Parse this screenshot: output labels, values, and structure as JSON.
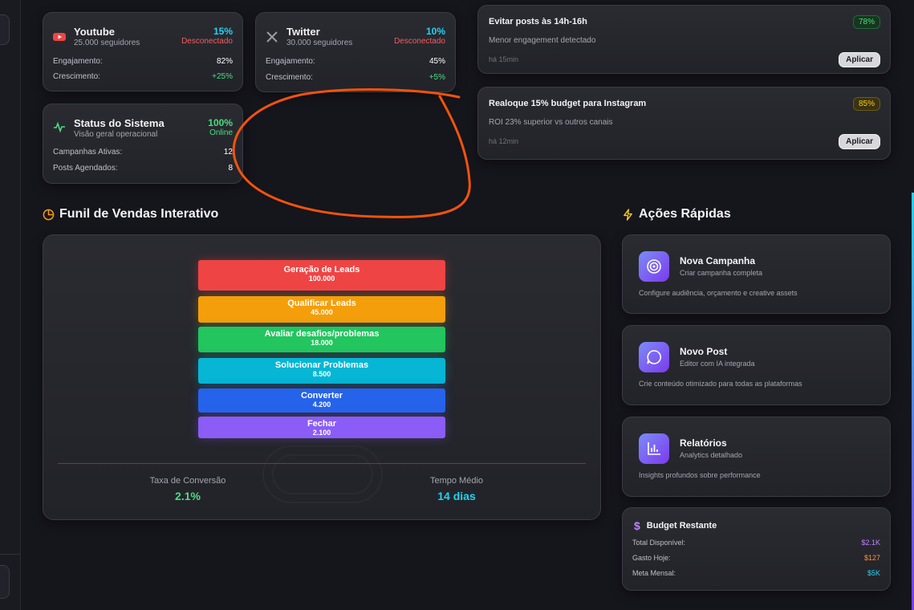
{
  "social": [
    {
      "name": "Youtube",
      "followers": "25.000 seguidores",
      "percent": "15%",
      "status": "Desconectado",
      "engagement_label": "Engajamento:",
      "engagement": "82%",
      "growth_label": "Crescimento:",
      "growth": "+25%"
    },
    {
      "name": "Twitter",
      "followers": "30.000 seguidores",
      "percent": "10%",
      "status": "Desconectado",
      "engagement_label": "Engajamento:",
      "engagement": "45%",
      "growth_label": "Crescimento:",
      "growth": "+5%"
    }
  ],
  "system": {
    "title": "Status do Sistema",
    "subtitle": "Visão geral operacional",
    "percent": "100%",
    "status": "Online",
    "rows": [
      {
        "label": "Campanhas Ativas:",
        "value": "12"
      },
      {
        "label": "Posts Agendados:",
        "value": "8"
      }
    ]
  },
  "recommendations": [
    {
      "title": "Evitar posts às 14h-16h",
      "desc": "Menor engagement detectado",
      "time": "há 15min",
      "score": "78%",
      "color": "#4ade80",
      "action": "Aplicar"
    },
    {
      "title": "Realoque 15% budget para Instagram",
      "desc": "ROI 23% superior vs outros canais",
      "time": "há 12min",
      "score": "85%",
      "color": "#facc15",
      "action": "Aplicar"
    }
  ],
  "funnel": {
    "title": "Funil de Vendas Interativo",
    "stages": [
      {
        "label": "Geração de Leads",
        "value": "100.000",
        "color": "#ef4444"
      },
      {
        "label": "Qualificar Leads",
        "value": "45.000",
        "color": "#f59e0b"
      },
      {
        "label": "Avaliar desafios/problemas",
        "value": "18.000",
        "color": "#22c55e"
      },
      {
        "label": "Solucionar Problemas",
        "value": "8.500",
        "color": "#06b6d4"
      },
      {
        "label": "Converter",
        "value": "4.200",
        "color": "#2563eb"
      },
      {
        "label": "Fechar",
        "value": "2.100",
        "color": "#8b5cf6"
      }
    ],
    "conversion_label": "Taxa de Conversão",
    "conversion": "2.1%",
    "time_label": "Tempo Médio",
    "time": "14 dias"
  },
  "quick_actions": {
    "title": "Ações Rápidas",
    "items": [
      {
        "title": "Nova Campanha",
        "subtitle": "Criar campanha completa",
        "desc": "Configure audiência, orçamento e creative assets",
        "icon": "target-icon"
      },
      {
        "title": "Novo Post",
        "subtitle": "Editor com IA integrada",
        "desc": "Crie conteúdo otimizado para todas as plataformas",
        "icon": "chat-bubble-icon"
      },
      {
        "title": "Relatórios",
        "subtitle": "Analytics detalhado",
        "desc": "Insights profundos sobre performance",
        "icon": "bar-chart-icon"
      }
    ]
  },
  "budget": {
    "title": "Budget Restante",
    "rows": [
      {
        "label": "Total Disponível:",
        "value": "$2.1K",
        "color": "#c084fc"
      },
      {
        "label": "Gasto Hoje:",
        "value": "$127",
        "color": "#fb923c"
      },
      {
        "label": "Meta Mensal:",
        "value": "$5K",
        "color": "#22d3ee"
      }
    ]
  },
  "colors": {
    "accent_cyan": "#22d3ee",
    "danger": "#f25d5d",
    "success": "#4ade80",
    "annotation": "#f4530b"
  }
}
